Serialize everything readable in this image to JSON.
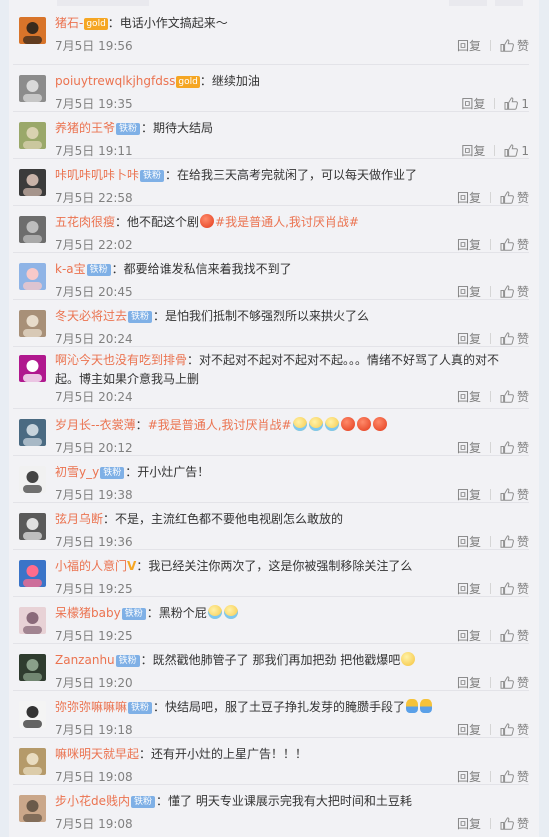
{
  "labels": {
    "reply": "回复",
    "like": "赞"
  },
  "colors": {
    "username": "#eb7350",
    "hashtag": "#eb7350",
    "fan_badge": "#7fb0e6",
    "meta_text": "#808080"
  },
  "comments": [
    {
      "name": "猪石-",
      "badges": [
        "gold"
      ],
      "text": "：电话小作文搞起来～",
      "time": "7月5日 19:56",
      "like": "赞"
    },
    {
      "name": "poiuytrewqlkjhgfdss",
      "badges": [
        "gold"
      ],
      "text": "：继续加油",
      "time": "7月5日 19:35",
      "like": "1"
    },
    {
      "name": "养猪的王爷",
      "badges": [
        "铁粉"
      ],
      "text": "：期待大结局",
      "time": "7月5日 19:11",
      "like": "1"
    },
    {
      "name": "咔叽咔叽咔卜咔",
      "badges": [
        "铁粉"
      ],
      "text": "：在给我三天高考完就闲了，可以每天做作业了",
      "time": "7月5日 22:58",
      "like": "赞"
    },
    {
      "name": "五花肉很瘦",
      "badges": [],
      "text": "：他不配这个剧",
      "emoji_mid": [
        "red"
      ],
      "tag": "#我是普通人,我讨厌肖战#",
      "time": "7月5日 22:02",
      "like": "赞"
    },
    {
      "name": "k-a宝",
      "badges": [
        "铁粉"
      ],
      "text": "：都要给谁发私信来着我找不到了",
      "time": "7月5日 20:45",
      "like": "赞"
    },
    {
      "name": "冬天必将过去",
      "badges": [
        "铁粉"
      ],
      "text": "：是怕我们抵制不够强烈所以来拱火了么",
      "time": "7月5日 20:24",
      "like": "赞"
    },
    {
      "name": "啊沁今天也没有吃到排骨",
      "badges": [],
      "text": "：对不起对不起对不起对不起。。。情绪不好骂了人真的对不",
      "text2": "起。博主如果介意我马上删",
      "time": "7月5日 20:24",
      "like": "赞"
    },
    {
      "name": "岁月长--衣裳薄",
      "badges": [],
      "text": "：",
      "tag": "#我是普通人,我讨厌肖战#",
      "emoji_end": [
        "cry",
        "cry",
        "cry",
        "red",
        "red",
        "red"
      ],
      "time": "7月5日 20:12",
      "like": "赞"
    },
    {
      "name": "初雪y_y",
      "badges": [
        "铁粉"
      ],
      "text": "：开小灶广告！",
      "time": "7月5日 19:38",
      "like": "赞"
    },
    {
      "name": "弦月乌断",
      "badges": [],
      "text": "：不是，主流红色都不要他电视剧怎么敢放的",
      "time": "7月5日 19:36",
      "like": "赞"
    },
    {
      "name": "小福的人意门",
      "badges": [
        "V"
      ],
      "text": "：我已经关注你两次了，这是你被强制移除关注了么",
      "time": "7月5日 19:25",
      "like": "赞"
    },
    {
      "name": "呆檬猪baby",
      "badges": [
        "铁粉"
      ],
      "text": "：黑粉个屁",
      "emoji_end": [
        "cry",
        "cry"
      ],
      "time": "7月5日 19:25",
      "like": "赞"
    },
    {
      "name": "Zanzanhu",
      "badges": [
        "铁粉"
      ],
      "text": "：既然戳他肺管子了 那我们再加把劲 把他戳爆吧",
      "emoji_end": [
        "smile"
      ],
      "time": "7月5日 19:20",
      "like": "赞"
    },
    {
      "name": "弥弥弥嘛嘛嘛",
      "badges": [
        "铁粉"
      ],
      "text": "：快结局吧，服了土豆子挣扎发芽的腌臜手段了",
      "emoji_end": [
        "fig",
        "fig"
      ],
      "time": "7月5日 19:18",
      "like": "赞"
    },
    {
      "name": "嘛咪明天就早起",
      "badges": [],
      "text": "：还有开小灶的上星广告！！！",
      "time": "7月5日 19:08",
      "like": "赞"
    },
    {
      "name": "步小花de贱内",
      "badges": [
        "铁粉"
      ],
      "text": "：懂了 明天专业课展示完我有大把时间和土豆耗",
      "time": "7月5日 19:08",
      "like": "赞"
    }
  ]
}
